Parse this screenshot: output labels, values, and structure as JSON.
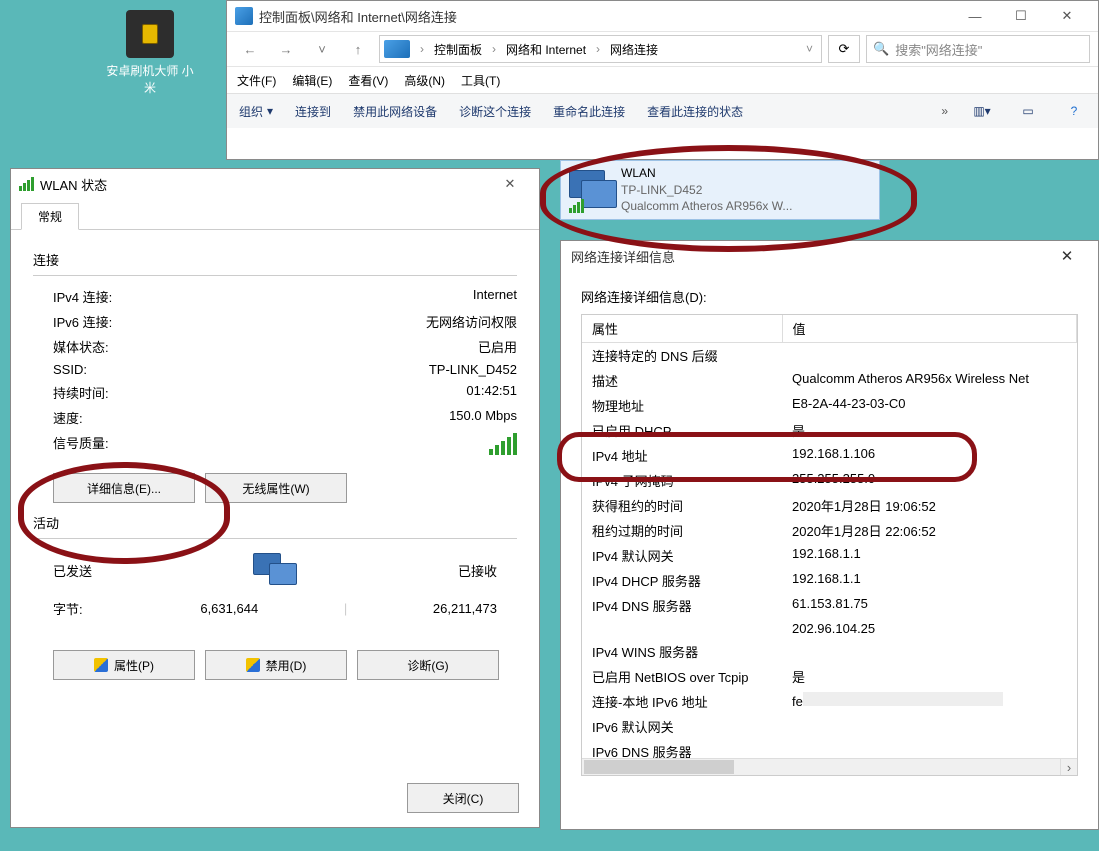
{
  "desktop": {
    "icon_label": "安卓刷机大师 小米"
  },
  "explorer": {
    "title": "控制面板\\网络和 Internet\\网络连接",
    "breadcrumb": [
      "控制面板",
      "网络和 Internet",
      "网络连接"
    ],
    "search_placeholder": "搜索\"网络连接\"",
    "menus": [
      "文件(F)",
      "编辑(E)",
      "查看(V)",
      "高级(N)",
      "工具(T)"
    ],
    "cmds": {
      "organize": "组织",
      "connect": "连接到",
      "disable": "禁用此网络设备",
      "diagnose": "诊断这个连接",
      "rename": "重命名此连接",
      "status": "查看此连接的状态",
      "more": "»"
    }
  },
  "adapter": {
    "name": "WLAN",
    "ssid": "TP-LINK_D452",
    "device": "Qualcomm Atheros AR956x W..."
  },
  "wlan": {
    "title": "WLAN 状态",
    "tab": "常规",
    "sect_conn": "连接",
    "rows": {
      "ipv4": "IPv4 连接:",
      "ipv4_v": "Internet",
      "ipv6": "IPv6 连接:",
      "ipv6_v": "无网络访问权限",
      "media": "媒体状态:",
      "media_v": "已启用",
      "ssid": "SSID:",
      "ssid_v": "TP-LINK_D452",
      "dur": "持续时间:",
      "dur_v": "01:42:51",
      "speed": "速度:",
      "speed_v": "150.0 Mbps",
      "sig": "信号质量:"
    },
    "btn_details": "详细信息(E)...",
    "btn_wireless": "无线属性(W)",
    "sect_act": "活动",
    "act_sent": "已发送",
    "act_recv": "已接收",
    "act_bytes_k": "字节:",
    "act_sent_v": "6,631,644",
    "act_recv_v": "26,211,473",
    "btn_prop": "属性(P)",
    "btn_disable": "禁用(D)",
    "btn_diag": "诊断(G)",
    "btn_close": "关闭(C)"
  },
  "details": {
    "title": "网络连接详细信息",
    "header": "网络连接详细信息(D):",
    "th_prop": "属性",
    "th_val": "值",
    "rows": [
      {
        "k": "连接特定的 DNS 后缀",
        "v": ""
      },
      {
        "k": "描述",
        "v": "Qualcomm Atheros AR956x Wireless Net"
      },
      {
        "k": "物理地址",
        "v": "E8-2A-44-23-03-C0"
      },
      {
        "k": "已启用 DHCP",
        "v": "是"
      },
      {
        "k": "IPv4 地址",
        "v": "192.168.1.106"
      },
      {
        "k": "IPv4 子网掩码",
        "v": "255.255.255.0"
      },
      {
        "k": "获得租约的时间",
        "v": "2020年1月28日 19:06:52"
      },
      {
        "k": "租约过期的时间",
        "v": "2020年1月28日 22:06:52"
      },
      {
        "k": "IPv4 默认网关",
        "v": "192.168.1.1"
      },
      {
        "k": "IPv4 DHCP 服务器",
        "v": "192.168.1.1"
      },
      {
        "k": "IPv4 DNS 服务器",
        "v": "61.153.81.75"
      },
      {
        "k": "",
        "v": "202.96.104.25"
      },
      {
        "k": "IPv4 WINS 服务器",
        "v": ""
      },
      {
        "k": "已启用 NetBIOS over Tcpip",
        "v": "是"
      },
      {
        "k": "连接-本地 IPv6 地址",
        "v": "fe"
      },
      {
        "k": "IPv6 默认网关",
        "v": ""
      },
      {
        "k": "IPv6 DNS 服务器",
        "v": ""
      }
    ]
  }
}
